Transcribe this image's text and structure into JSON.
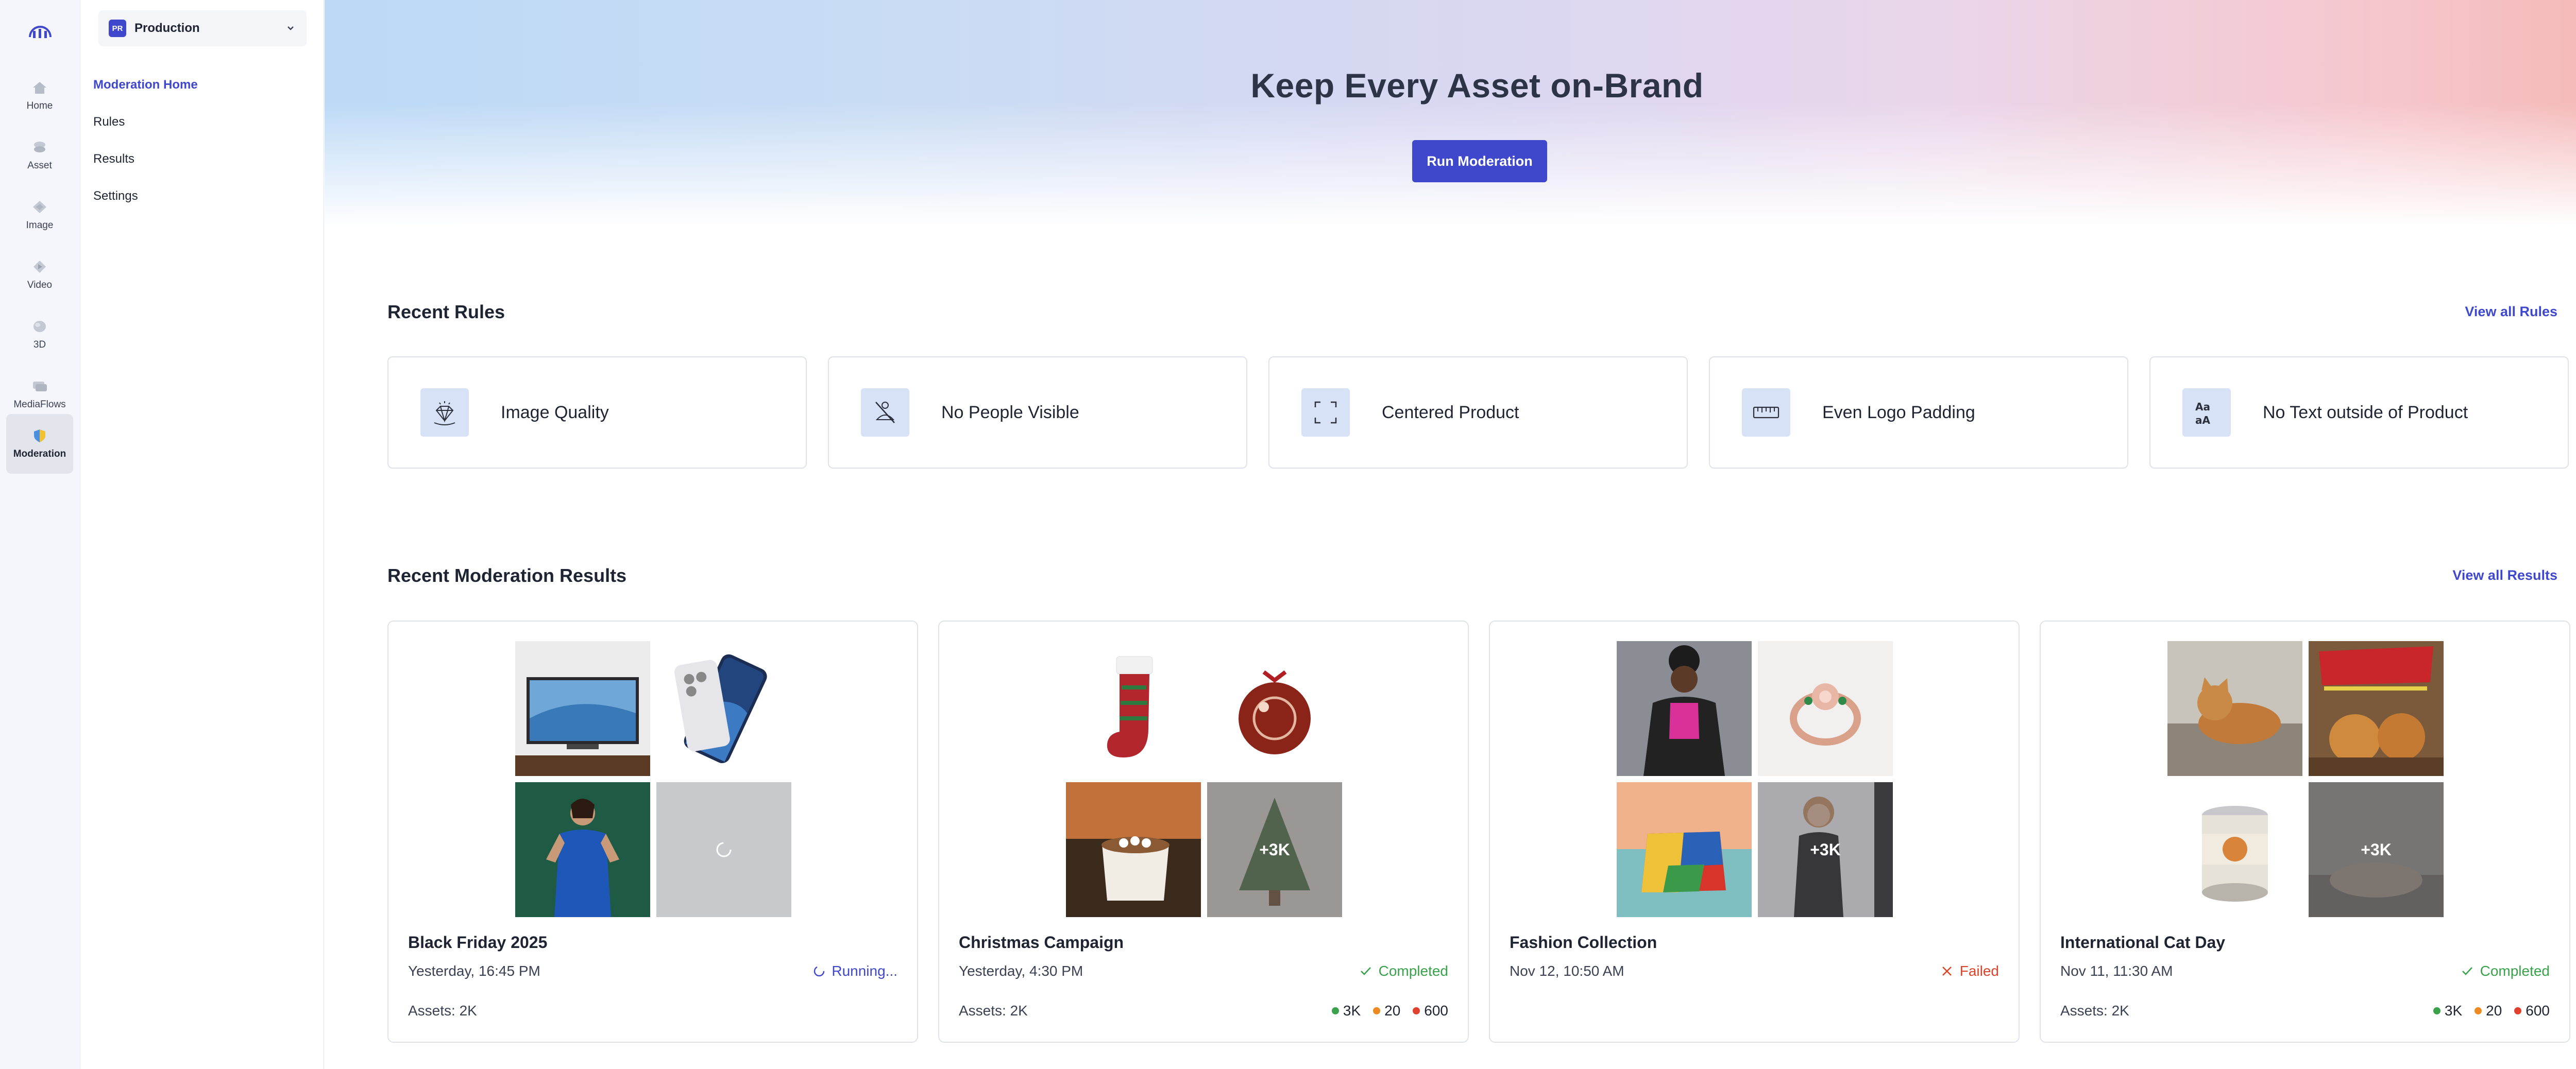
{
  "rail": {
    "items": [
      {
        "label": "Home",
        "icon": "home-icon"
      },
      {
        "label": "Asset",
        "icon": "asset-icon"
      },
      {
        "label": "Image",
        "icon": "image-icon"
      },
      {
        "label": "Video",
        "icon": "video-icon"
      },
      {
        "label": "3D",
        "icon": "cube-icon"
      },
      {
        "label": "MediaFlows",
        "icon": "mediaflows-icon"
      },
      {
        "label": "Moderation",
        "icon": "shield-icon",
        "active": true
      }
    ]
  },
  "env": {
    "badge": "PR",
    "name": "Production"
  },
  "subnav": {
    "items": [
      {
        "label": "Moderation Home",
        "active": true
      },
      {
        "label": "Rules"
      },
      {
        "label": "Results"
      },
      {
        "label": "Settings"
      }
    ]
  },
  "hero": {
    "title": "Keep Every Asset on-Brand",
    "button": "Run Moderation"
  },
  "rules": {
    "title": "Recent Rules",
    "link": "View all Rules",
    "items": [
      {
        "name": "Image Quality",
        "icon": "diamond-icon"
      },
      {
        "name": "No People Visible",
        "icon": "no-person-icon"
      },
      {
        "name": "Centered Product",
        "icon": "focus-frame-icon"
      },
      {
        "name": "Even Logo Padding",
        "icon": "ruler-icon"
      },
      {
        "name": "No Text outside of Product",
        "icon": "text-case-icon"
      }
    ]
  },
  "results": {
    "title": "Recent Moderation Results",
    "link": "View all Results",
    "items": [
      {
        "title": "Black Friday 2025",
        "date": "Yesterday, 16:45 PM",
        "status": "Running...",
        "assets": "Assets: 2K",
        "counts": []
      },
      {
        "title": "Christmas Campaign",
        "date": "Yesterday, 4:30 PM",
        "status": "Completed",
        "assets": "Assets: 2K",
        "counts": [
          "3K",
          "20",
          "600"
        ],
        "more": "+3K"
      },
      {
        "title": "Fashion Collection",
        "date": "Nov 12, 10:50 AM",
        "status": "Failed",
        "assets": "",
        "counts": [],
        "more": "+3K"
      },
      {
        "title": "International Cat Day",
        "date": "Nov 11, 11:30 AM",
        "status": "Completed",
        "assets": "Assets: 2K",
        "counts": [
          "3K",
          "20",
          "600"
        ],
        "more": "+3K"
      }
    ]
  },
  "colors": {
    "accent": "#3f48cc",
    "success": "#3aa24a",
    "failed": "#d9452b",
    "warning": "#ef8a22",
    "danger": "#e2402f"
  }
}
